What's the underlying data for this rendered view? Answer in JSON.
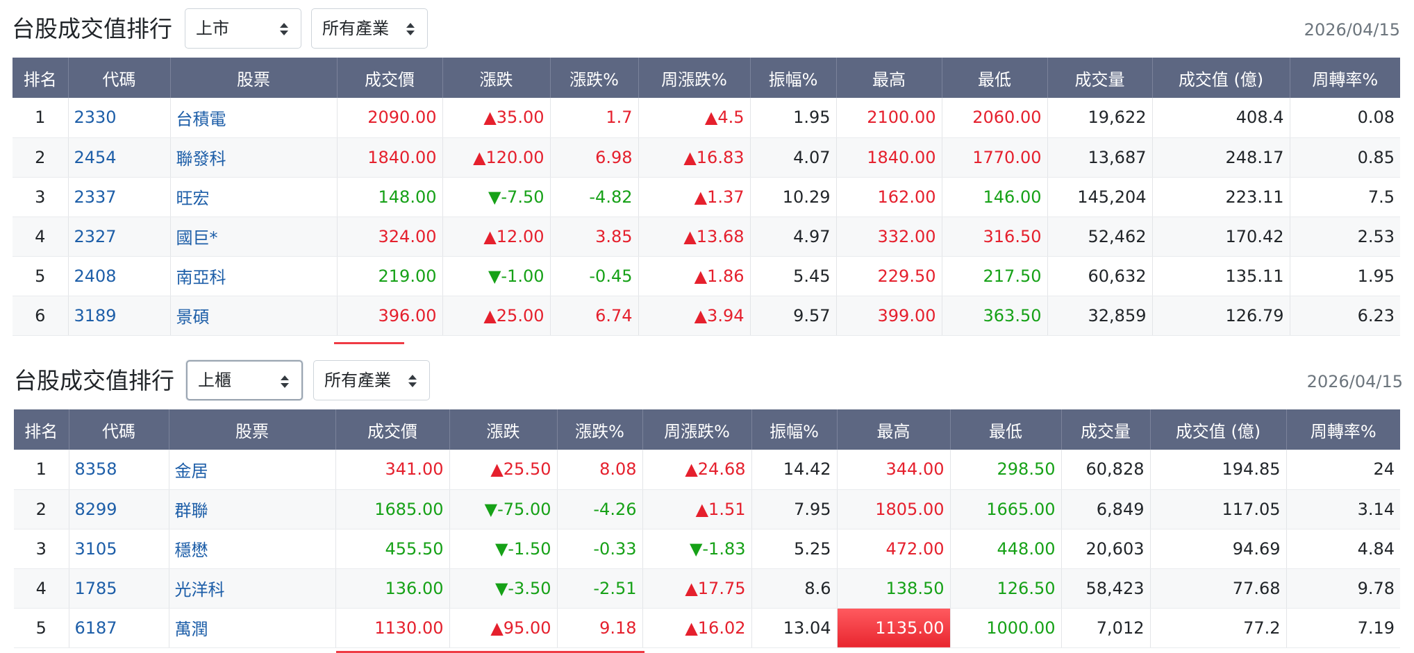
{
  "sections": [
    {
      "title": "台股成交值排行",
      "market": "上市",
      "industry": "所有產業",
      "date": "2026/04/15",
      "rows": [
        {
          "rank": "1",
          "code": "2330",
          "name": "台積電",
          "price": "2090.00",
          "price_dir": "up",
          "change": "▲35.00",
          "change_dir": "up",
          "change_pct": "1.7",
          "change_pct_dir": "up",
          "week_change": "▲4.5",
          "week_dir": "up",
          "amplitude": "1.95",
          "high": "2100.00",
          "high_dir": "up",
          "low": "2060.00",
          "low_dir": "up",
          "volume": "19,622",
          "turnover": "408.4",
          "week_turnover_rate": "0.08"
        },
        {
          "rank": "2",
          "code": "2454",
          "name": "聯發科",
          "price": "1840.00",
          "price_dir": "up",
          "change": "▲120.00",
          "change_dir": "up",
          "change_pct": "6.98",
          "change_pct_dir": "up",
          "week_change": "▲16.83",
          "week_dir": "up",
          "amplitude": "4.07",
          "high": "1840.00",
          "high_dir": "up",
          "low": "1770.00",
          "low_dir": "up",
          "volume": "13,687",
          "turnover": "248.17",
          "week_turnover_rate": "0.85"
        },
        {
          "rank": "3",
          "code": "2337",
          "name": "旺宏",
          "price": "148.00",
          "price_dir": "down",
          "change": "▼-7.50",
          "change_dir": "down",
          "change_pct": "-4.82",
          "change_pct_dir": "down",
          "week_change": "▲1.37",
          "week_dir": "up",
          "amplitude": "10.29",
          "high": "162.00",
          "high_dir": "up",
          "low": "146.00",
          "low_dir": "down",
          "volume": "145,204",
          "turnover": "223.11",
          "week_turnover_rate": "7.5"
        },
        {
          "rank": "4",
          "code": "2327",
          "name": "國巨*",
          "price": "324.00",
          "price_dir": "up",
          "change": "▲12.00",
          "change_dir": "up",
          "change_pct": "3.85",
          "change_pct_dir": "up",
          "week_change": "▲13.68",
          "week_dir": "up",
          "amplitude": "4.97",
          "high": "332.00",
          "high_dir": "up",
          "low": "316.50",
          "low_dir": "up",
          "volume": "52,462",
          "turnover": "170.42",
          "week_turnover_rate": "2.53"
        },
        {
          "rank": "5",
          "code": "2408",
          "name": "南亞科",
          "price": "219.00",
          "price_dir": "down",
          "change": "▼-1.00",
          "change_dir": "down",
          "change_pct": "-0.45",
          "change_pct_dir": "down",
          "week_change": "▲1.86",
          "week_dir": "up",
          "amplitude": "5.45",
          "high": "229.50",
          "high_dir": "up",
          "low": "217.50",
          "low_dir": "down",
          "volume": "60,632",
          "turnover": "135.11",
          "week_turnover_rate": "1.95"
        },
        {
          "rank": "6",
          "code": "3189",
          "name": "景碩",
          "price": "396.00",
          "price_dir": "up",
          "change": "▲25.00",
          "change_dir": "up",
          "change_pct": "6.74",
          "change_pct_dir": "up",
          "week_change": "▲3.94",
          "week_dir": "up",
          "amplitude": "9.57",
          "high": "399.00",
          "high_dir": "up",
          "low": "363.50",
          "low_dir": "down",
          "volume": "32,859",
          "turnover": "126.79",
          "week_turnover_rate": "6.23"
        }
      ]
    },
    {
      "title": "台股成交值排行",
      "market": "上櫃",
      "industry": "所有產業",
      "date": "2026/04/15",
      "rows": [
        {
          "rank": "1",
          "code": "8358",
          "name": "金居",
          "price": "341.00",
          "price_dir": "up",
          "change": "▲25.50",
          "change_dir": "up",
          "change_pct": "8.08",
          "change_pct_dir": "up",
          "week_change": "▲24.68",
          "week_dir": "up",
          "amplitude": "14.42",
          "high": "344.00",
          "high_dir": "up",
          "low": "298.50",
          "low_dir": "down",
          "volume": "60,828",
          "turnover": "194.85",
          "week_turnover_rate": "24"
        },
        {
          "rank": "2",
          "code": "8299",
          "name": "群聯",
          "price": "1685.00",
          "price_dir": "down",
          "change": "▼-75.00",
          "change_dir": "down",
          "change_pct": "-4.26",
          "change_pct_dir": "down",
          "week_change": "▲1.51",
          "week_dir": "up",
          "amplitude": "7.95",
          "high": "1805.00",
          "high_dir": "up",
          "low": "1665.00",
          "low_dir": "down",
          "volume": "6,849",
          "turnover": "117.05",
          "week_turnover_rate": "3.14"
        },
        {
          "rank": "3",
          "code": "3105",
          "name": "穩懋",
          "price": "455.50",
          "price_dir": "down",
          "change": "▼-1.50",
          "change_dir": "down",
          "change_pct": "-0.33",
          "change_pct_dir": "down",
          "week_change": "▼-1.83",
          "week_dir": "down",
          "amplitude": "5.25",
          "high": "472.00",
          "high_dir": "up",
          "low": "448.00",
          "low_dir": "down",
          "volume": "20,603",
          "turnover": "94.69",
          "week_turnover_rate": "4.84"
        },
        {
          "rank": "4",
          "code": "1785",
          "name": "光洋科",
          "price": "136.00",
          "price_dir": "down",
          "change": "▼-3.50",
          "change_dir": "down",
          "change_pct": "-2.51",
          "change_pct_dir": "down",
          "week_change": "▲17.75",
          "week_dir": "up",
          "amplitude": "8.6",
          "high": "138.50",
          "high_dir": "down",
          "low": "126.50",
          "low_dir": "down",
          "volume": "58,423",
          "turnover": "77.68",
          "week_turnover_rate": "9.78"
        },
        {
          "rank": "5",
          "code": "6187",
          "name": "萬潤",
          "price": "1130.00",
          "price_dir": "up",
          "change": "▲95.00",
          "change_dir": "up",
          "change_pct": "9.18",
          "change_pct_dir": "up",
          "week_change": "▲16.02",
          "week_dir": "up",
          "amplitude": "13.04",
          "high": "1135.00",
          "high_dir": "limit-up",
          "low": "1000.00",
          "low_dir": "down",
          "volume": "7,012",
          "turnover": "77.2",
          "week_turnover_rate": "7.19"
        }
      ]
    }
  ],
  "columns": [
    "排名",
    "代碼",
    "股票",
    "成交價",
    "漲跌",
    "漲跌%",
    "周漲跌%",
    "振幅%",
    "最高",
    "最低",
    "成交量",
    "成交值 (億)",
    "周轉率%"
  ],
  "colors": {
    "up": "#e5202d",
    "down": "#16a117",
    "header_bg": "#5d6782",
    "link": "#1d5ea8"
  }
}
